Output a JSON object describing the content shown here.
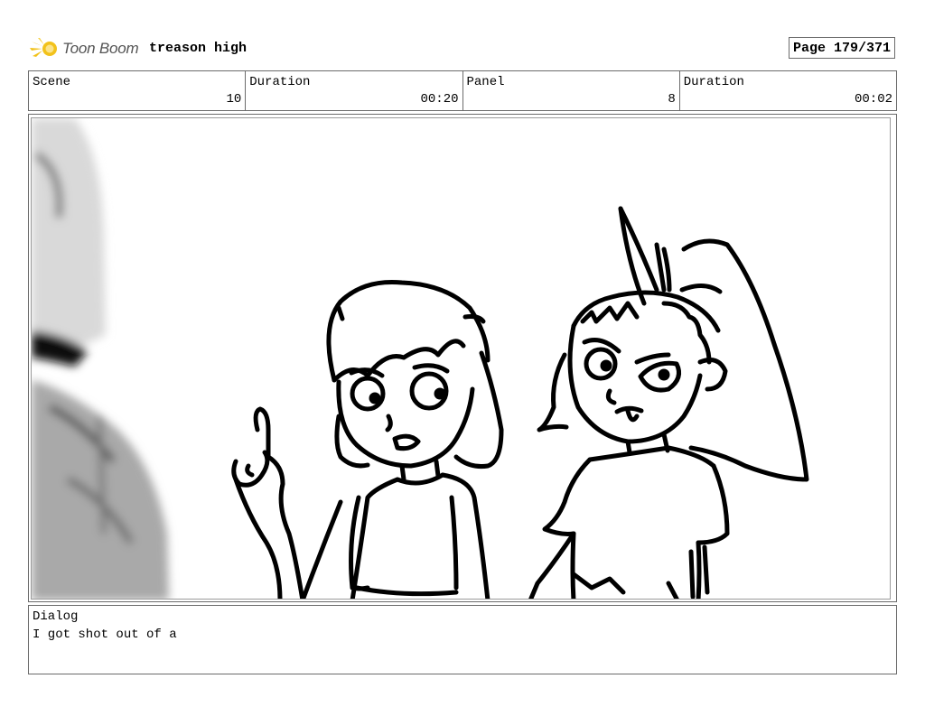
{
  "header": {
    "logo_text": "Toon Boom",
    "project_title": "treason high",
    "page": "Page 179/371"
  },
  "info": [
    {
      "label": "Scene",
      "value": "10"
    },
    {
      "label": "Duration",
      "value": "00:20"
    },
    {
      "label": "Panel",
      "value": "8"
    },
    {
      "label": "Duration",
      "value": "00:02"
    }
  ],
  "panel": {
    "icon": "storyboard-sketch"
  },
  "dialog": {
    "label": "Dialog",
    "text": "I got shot out of a"
  },
  "colors": {
    "border": "#6b6b6b",
    "logo_yellow": "#f2c21b"
  }
}
